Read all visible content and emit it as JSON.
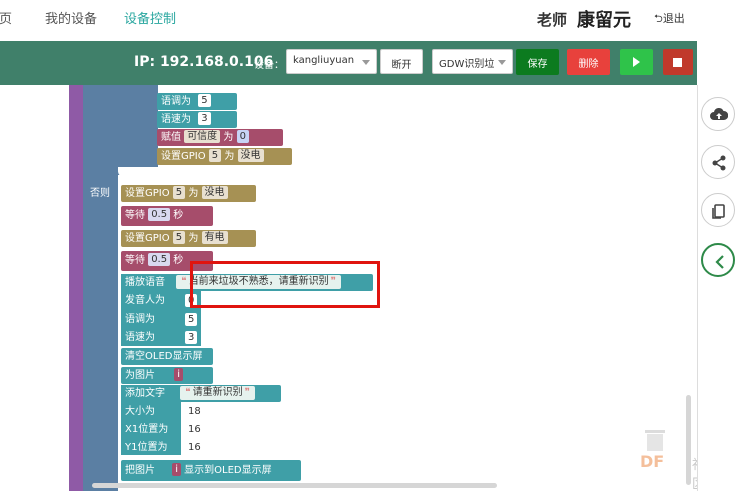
{
  "nav": {
    "home_partial": "首页",
    "my_devices": "我的设备",
    "device_control": "设备控制",
    "user_role": "老师",
    "user_name": "康留元",
    "logout": "退出"
  },
  "toolbar": {
    "ip_label": "IP: 192.168.0.106",
    "device_label": "设备：",
    "device_value": "kangliuyuan",
    "disconnect_label": "断开",
    "program_value": "GDW识别垃",
    "save_label": "保存",
    "delete_label": "删除"
  },
  "blocks": {
    "tone": "语调为",
    "tone_val": "5",
    "speed": "语速为",
    "speed_val": "3",
    "assign": "赋值",
    "assign_var": "可信度",
    "assign_to": "为",
    "assign_val": "0",
    "set_gpio": "设置GPIO",
    "gpio_pin": "5",
    "gpio_to": "为",
    "no_power": "没电",
    "else": "否则",
    "else_gpio": "设置GPIO",
    "else_pin": "5",
    "else_to": "为",
    "else_no_power": "没电",
    "wait": "等待",
    "wait_val": "0.5",
    "wait_unit": "秒",
    "set_gpio2": "设置GPIO",
    "gpio2_pin": "5",
    "gpio2_to": "为",
    "has_power": "有电",
    "wait2": "等待",
    "wait2_val": "0.5",
    "wait2_unit": "秒",
    "play_voice": "播放语音",
    "voice_text": "当前来垃圾不熟悉，请重新识别",
    "speaker": "发音人为",
    "speaker_val": "0",
    "tone2": "语调为",
    "tone2_val": "5",
    "speed2": "语速为",
    "speed2_val": "3",
    "clear_oled": "清空OLED显示屏",
    "as_image": "为图片",
    "image_var": "i",
    "add_text": "添加文字",
    "add_text_val": "请重新识别",
    "size": "大小为",
    "size_val": "18",
    "x1": "X1位置为",
    "x1_val": "16",
    "y1": "Y1位置为",
    "y1_val": "16",
    "draw_image": "把图片",
    "draw_var": "i",
    "draw_to": "显示到OLED显示屏"
  },
  "watermark": {
    "brand": "DF",
    "suffix": "社区"
  },
  "colors": {
    "toolbar": "#40806a",
    "accent": "#2aa7a0",
    "highlight": "#e0140f"
  }
}
